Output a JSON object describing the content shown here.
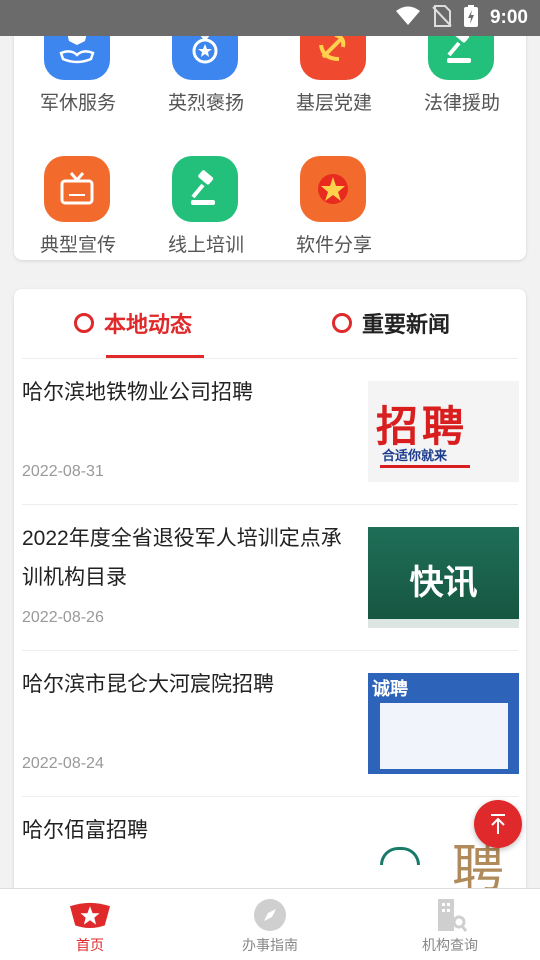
{
  "status_bar": {
    "time": "9:00"
  },
  "service_grid": [
    {
      "label": "军休服务",
      "icon": "hand-shield-icon",
      "color": "#3d86f0"
    },
    {
      "label": "英烈褒扬",
      "icon": "medal-icon",
      "color": "#3d86f0"
    },
    {
      "label": "基层党建",
      "icon": "party-emblem-icon",
      "color": "#ef4a2f"
    },
    {
      "label": "法律援助",
      "icon": "gavel-icon",
      "color": "#22c07a"
    },
    {
      "label": "典型宣传",
      "icon": "tv-icon",
      "color": "#f26b2c"
    },
    {
      "label": "线上培训",
      "icon": "gavel-icon",
      "color": "#22c07a"
    },
    {
      "label": "软件分享",
      "icon": "star-icon",
      "color": "#f26b2c"
    }
  ],
  "news": {
    "tabs": [
      {
        "label": "本地动态",
        "active": true
      },
      {
        "label": "重要新闻",
        "active": false
      }
    ],
    "items": [
      {
        "title": "哈尔滨地铁物业公司招聘",
        "date": "2022-08-31",
        "thumb_text": "招聘",
        "thumb_sub": "合适你就来"
      },
      {
        "title": "2022年度全省退役军人培训定点承训机构目录",
        "date": "2022-08-26",
        "thumb_text": "快讯"
      },
      {
        "title": "哈尔滨市昆仑大河宸院招聘",
        "date": "2022-08-24",
        "thumb_text": "诚聘"
      },
      {
        "title": "哈尔佰富招聘",
        "date": "",
        "thumb_text": "聘"
      }
    ]
  },
  "bottom_nav": [
    {
      "label": "首页",
      "icon": "home-star-icon",
      "active": true
    },
    {
      "label": "办事指南",
      "icon": "compass-icon",
      "active": false
    },
    {
      "label": "机构查询",
      "icon": "building-search-icon",
      "active": false
    }
  ],
  "colors": {
    "accent": "#e0292a",
    "blue": "#3d86f0",
    "green": "#22c07a",
    "orange": "#f26b2c"
  }
}
